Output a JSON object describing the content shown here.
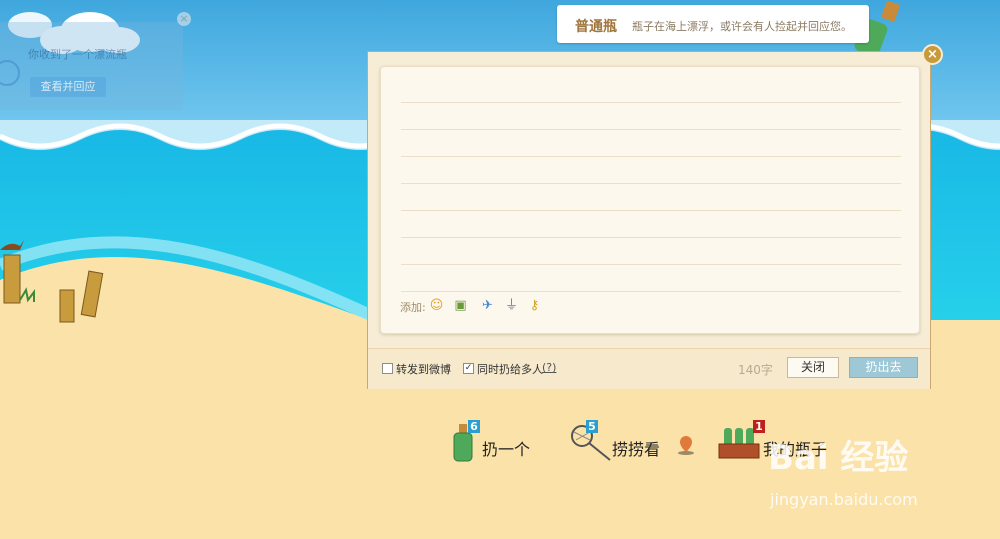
{
  "notice": {
    "text": "你收到了一个漂流瓶",
    "button_label": "查看并回应",
    "close_symbol": "×"
  },
  "tip": {
    "title": "普通瓶",
    "text": "瓶子在海上漂浮，或许会有人捡起并回应您。"
  },
  "composer": {
    "close_symbol": "×",
    "attach_label": "添加:",
    "attach_icons": [
      "emoji-icon",
      "image-icon",
      "airplane-icon",
      "microphone-icon",
      "key-icon"
    ],
    "forward_label": "转发到微博",
    "forward_checked": false,
    "multi_label": "同时扔给多人",
    "multi_help": "(?)",
    "multi_checked": true,
    "char_count": "140字",
    "close_label": "关闭",
    "throw_label": "扔出去"
  },
  "actions": [
    {
      "label": "扔一个",
      "count": "6",
      "icon": "bottle-icon"
    },
    {
      "label": "捞捞看",
      "count": "5",
      "icon": "net-icon"
    },
    {
      "label": "我的瓶子",
      "count": "1",
      "icon": "bottle-basket-icon"
    }
  ],
  "watermark": {
    "main": "Bai 经验",
    "sub": "jingyan.baidu.com"
  },
  "colors": {
    "sky": "#48aee0",
    "sea": "#1fc3e6",
    "sand": "#fbe2a8",
    "panel_border": "#c9a872",
    "throw_button": "#9ec8d6"
  }
}
